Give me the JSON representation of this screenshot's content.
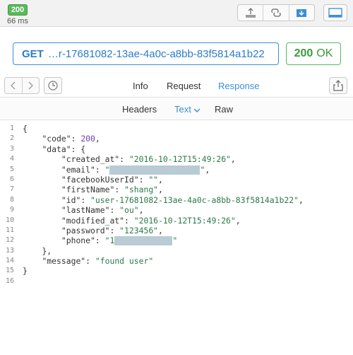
{
  "topbar": {
    "status_code": "200",
    "status_time": "66 ms",
    "icons": [
      "export-icon",
      "link-icon",
      "download-icon",
      "panel-icon"
    ]
  },
  "url": {
    "method": "GET",
    "value": "…r-17681082-13ae-4a0c-a8bb-83f5814a1b22"
  },
  "status": {
    "code": "200",
    "text": "OK"
  },
  "nav": {
    "tabs": [
      "Info",
      "Request",
      "Response"
    ],
    "active": "Response"
  },
  "format": {
    "tabs": [
      "Headers",
      "Text",
      "Raw"
    ],
    "active": "Text"
  },
  "code": {
    "line_numbers": [
      "1",
      "2",
      "3",
      "4",
      "5",
      "6",
      "7",
      "8",
      "9",
      "10",
      "11",
      "12",
      "13",
      "14",
      "15",
      "16"
    ],
    "open_brace": "{",
    "code_key": "\"code\"",
    "code_val": "200",
    "data_key": "\"data\"",
    "created_at_key": "\"created_at\"",
    "created_at_val": "\"2016-10-12T15:49:26\"",
    "email_key": "\"email\"",
    "email_val_start": "\"",
    "email_val_end": "\"",
    "facebook_key": "\"facebookUserId\"",
    "facebook_val": "\"\"",
    "firstname_key": "\"firstName\"",
    "firstname_val": "\"shang\"",
    "id_key": "\"id\"",
    "id_val": "\"user-17681082-13ae-4a0c-a8bb-83f5814a1b22\"",
    "lastname_key": "\"lastName\"",
    "lastname_val": "\"ou\"",
    "modified_key": "\"modified_at\"",
    "modified_val": "\"2016-10-12T15:49:26\"",
    "password_key": "\"password\"",
    "password_val": "\"123456\"",
    "phone_key": "\"phone\"",
    "phone_val_start": "\"1",
    "phone_val_end": "\"",
    "close_data": "},",
    "message_key": "\"message\"",
    "message_val": "\"found user\"",
    "close_brace": "}"
  },
  "colors": {
    "accent": "#3a8fd6",
    "success": "#5cb85c",
    "string": "#2a7a4a",
    "number": "#6a3fb0",
    "redaction": "#b9cbd4"
  }
}
